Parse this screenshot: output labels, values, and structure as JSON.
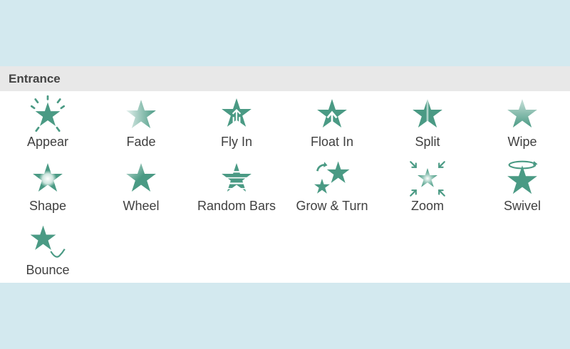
{
  "panel": {
    "header": "Entrance",
    "icon_color": "#4a9a84",
    "background_color": "#d3e9ef"
  },
  "effects": [
    {
      "label": "Appear",
      "icon": "appear-star-icon"
    },
    {
      "label": "Fade",
      "icon": "fade-star-icon"
    },
    {
      "label": "Fly In",
      "icon": "fly-in-star-icon"
    },
    {
      "label": "Float In",
      "icon": "float-in-star-icon"
    },
    {
      "label": "Split",
      "icon": "split-star-icon"
    },
    {
      "label": "Wipe",
      "icon": "wipe-star-icon"
    },
    {
      "label": "Shape",
      "icon": "shape-star-icon"
    },
    {
      "label": "Wheel",
      "icon": "wheel-star-icon"
    },
    {
      "label": "Random Bars",
      "icon": "random-bars-star-icon"
    },
    {
      "label": "Grow & Turn",
      "icon": "grow-turn-star-icon"
    },
    {
      "label": "Zoom",
      "icon": "zoom-star-icon"
    },
    {
      "label": "Swivel",
      "icon": "swivel-star-icon"
    },
    {
      "label": "Bounce",
      "icon": "bounce-star-icon"
    }
  ]
}
